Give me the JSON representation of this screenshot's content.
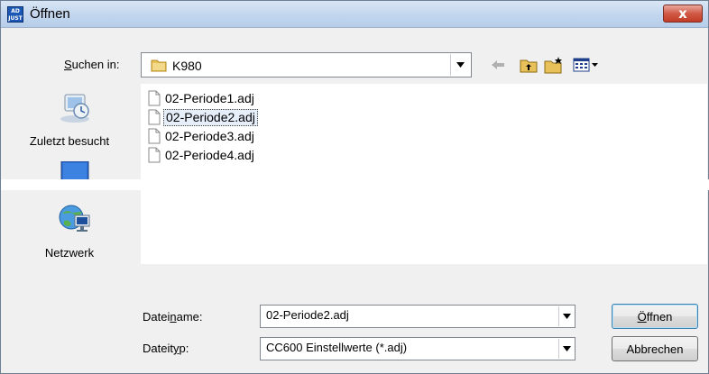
{
  "window": {
    "title": "Öffnen",
    "app_icon_text": "AD JUST",
    "close_symbol": "x",
    "accent_color": "#c23c25"
  },
  "lookin": {
    "label_prefix": "",
    "label_accel": "S",
    "label_rest": "uchen in:",
    "current_folder": "K980",
    "folder_icon": "folder-icon"
  },
  "toolbar": {
    "icons": [
      "back-arrow-icon",
      "up-folder-icon",
      "new-folder-icon",
      "view-menu-icon"
    ]
  },
  "places": [
    {
      "label": "Zuletzt besucht",
      "icon": "recent-places-icon"
    },
    {
      "label": "",
      "icon": "desktop-icon"
    },
    {
      "label": "Netzwerk",
      "icon": "network-icon"
    }
  ],
  "files": [
    {
      "name": "02-Periode1.adj",
      "selected": false
    },
    {
      "name": "02-Periode2.adj",
      "selected": true
    },
    {
      "name": "02-Periode3.adj",
      "selected": false
    },
    {
      "name": "02-Periode4.adj",
      "selected": false
    }
  ],
  "filename": {
    "label_prefix": "Datei",
    "label_accel": "n",
    "label_rest": "ame:",
    "value": "02-Periode2.adj"
  },
  "filetype": {
    "label_prefix": "Dateit",
    "label_accel": "y",
    "label_rest": "p:",
    "value": "CC600 Einstellwerte (*.adj)"
  },
  "buttons": {
    "open_accel": "Ö",
    "open_rest": "ffnen",
    "cancel": "Abbrechen"
  }
}
